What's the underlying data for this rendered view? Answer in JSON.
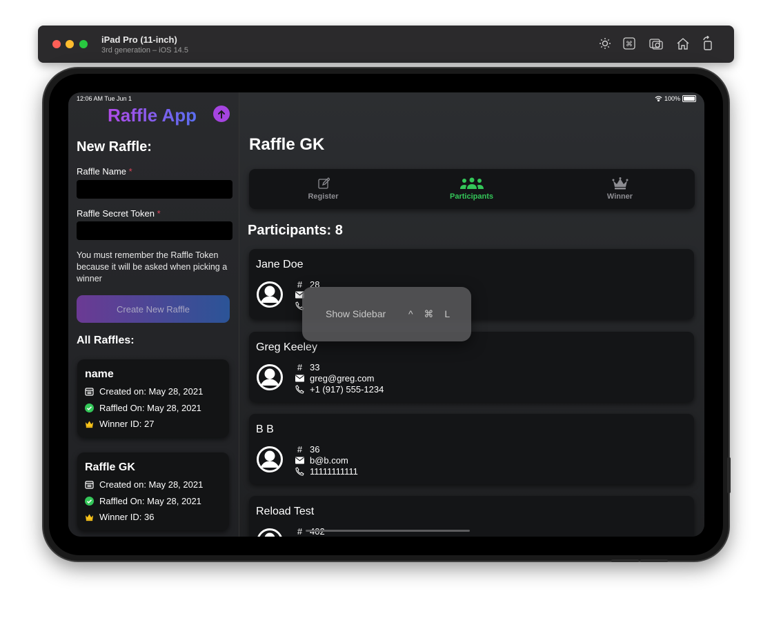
{
  "simulator": {
    "device_name": "iPad Pro (11-inch)",
    "device_subtitle": "3rd generation – iOS 14.5",
    "toolbar_icons": [
      "brightness-icon",
      "command-icon",
      "screenshot-icon",
      "home-icon",
      "rotate-icon"
    ]
  },
  "status_bar": {
    "time": "12:06 AM  Tue Jun 1",
    "battery": "100%"
  },
  "sidebar": {
    "app_title": "Raffle App",
    "new_raffle_heading": "New Raffle:",
    "raffle_name_label": "Raffle Name",
    "raffle_name_value": "",
    "raffle_token_label": "Raffle Secret Token",
    "raffle_token_value": "",
    "required_mark": "*",
    "help_text": "You must remember the Raffle Token because it will be asked when picking a winner",
    "create_button": "Create New Raffle",
    "all_raffles_heading": "All Raffles:",
    "raffles": [
      {
        "name": "name",
        "created": "Created on: May 28, 2021",
        "raffled": "Raffled On: May 28, 2021",
        "winner": "Winner ID: 27"
      },
      {
        "name": "Raffle GK",
        "created": "Created on: May 28, 2021",
        "raffled": "Raffled On: May 28, 2021",
        "winner": "Winner ID: 36"
      }
    ]
  },
  "main": {
    "title": "Raffle GK",
    "tabs": [
      {
        "label": "Register",
        "icon": "compose-icon"
      },
      {
        "label": "Participants",
        "icon": "people-icon",
        "active": true
      },
      {
        "label": "Winner",
        "icon": "crown-icon"
      }
    ],
    "participants_heading": "Participants: 8",
    "participants": [
      {
        "name": "Jane Doe",
        "id": "28",
        "email": "",
        "phone": ""
      },
      {
        "name": "Greg Keeley",
        "id": "33",
        "email": "greg@greg.com",
        "phone": "+1 (917) 555-1234"
      },
      {
        "name": "B B",
        "id": "36",
        "email": "b@b.com",
        "phone": "11111111111"
      },
      {
        "name": "Reload Test",
        "id": "402",
        "email": "",
        "phone": ""
      }
    ]
  },
  "tooltip": {
    "label": "Show Sidebar",
    "shortcut": "^ ⌘ L"
  },
  "colors": {
    "accent_green": "#34c759",
    "accent_purple": "#a544e0",
    "required_red": "#e0455a",
    "crown_gold": "#f7c21a"
  }
}
